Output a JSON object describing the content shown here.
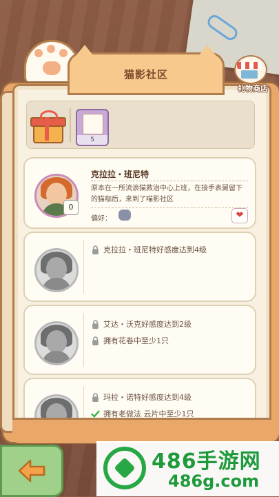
{
  "header": {
    "title": "猫影社区"
  },
  "shop": {
    "label": "礼物商店"
  },
  "rewards": {
    "scroll_count": "5"
  },
  "cards": [
    {
      "name": "克拉拉・班尼特",
      "description": "原本在一所流浪猫救治中心上班，在接手表舅留下的猫咖后，来到了喵影社区",
      "pref_label": "偏好：",
      "affinity": "0",
      "unlocked": true
    },
    {
      "conditions": [
        {
          "text": "克拉拉・班尼特好感度达到4级",
          "status": "locked"
        }
      ]
    },
    {
      "conditions": [
        {
          "text": "艾达・沃克好感度达到2级",
          "status": "locked"
        },
        {
          "text": "拥有花卷中至少1只",
          "status": "locked"
        }
      ]
    },
    {
      "conditions": [
        {
          "text": "玛拉・诺特好感度达到4级",
          "status": "locked"
        },
        {
          "text": "拥有老做法 云片中至少1只",
          "status": "done"
        }
      ]
    }
  ],
  "watermark": {
    "title": "486手游网",
    "url": "486g.com"
  },
  "colors": {
    "accent": "#f7c98d",
    "border": "#b07c4c",
    "back_button": "#9fd18a",
    "watermark_green": "#1e9a3c"
  }
}
